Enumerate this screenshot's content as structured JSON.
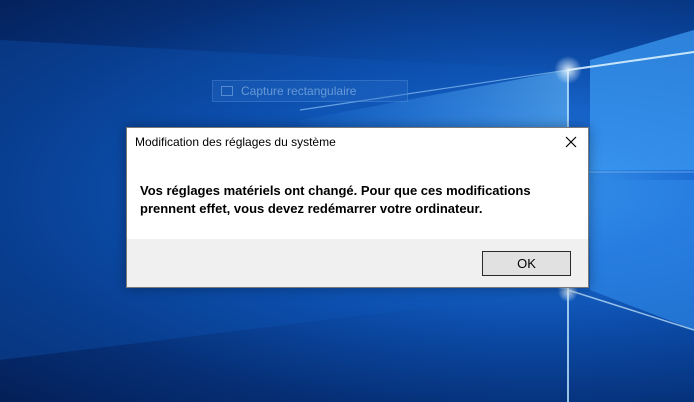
{
  "desktop": {
    "ghost_toolbar_label": "Capture rectangulaire"
  },
  "dialog": {
    "title": "Modification des réglages du système",
    "message": "Vos réglages matériels ont changé. Pour que ces modifications prennent effet, vous devez redémarrer votre ordinateur.",
    "ok_label": "OK",
    "close_icon": "close-icon"
  },
  "colors": {
    "wallpaper_dark": "#062f76",
    "wallpaper_light": "#3f9cf0",
    "dialog_footer": "#f0f0f0",
    "button_face": "#e1e1e1"
  }
}
